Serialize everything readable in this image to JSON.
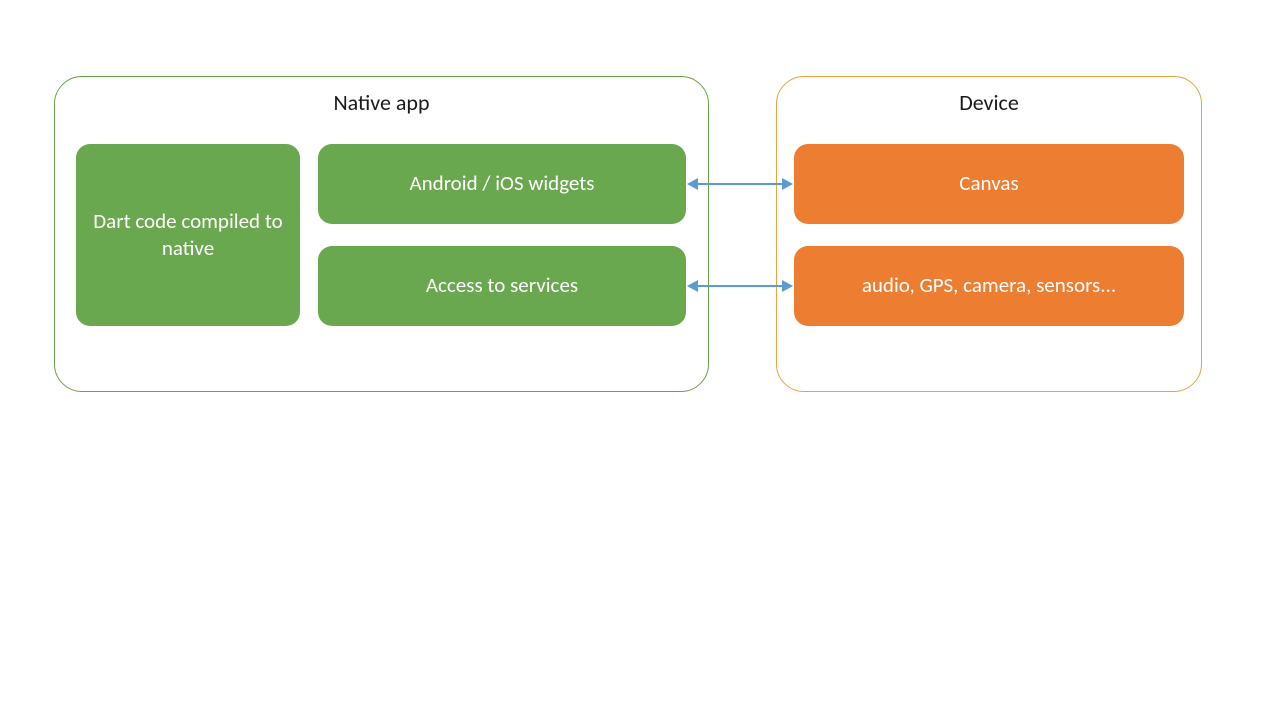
{
  "native_app": {
    "title": "Native app",
    "boxes": {
      "dart_code": "Dart code compiled to native",
      "widgets": "Android / iOS widgets",
      "services": "Access to services"
    }
  },
  "device": {
    "title": "Device",
    "boxes": {
      "canvas": "Canvas",
      "peripherals": "audio, GPS, camera, sensors..."
    }
  },
  "colors": {
    "green": "#6aa84f",
    "orange": "#ed7d31",
    "arrow": "#5b9bd5"
  }
}
